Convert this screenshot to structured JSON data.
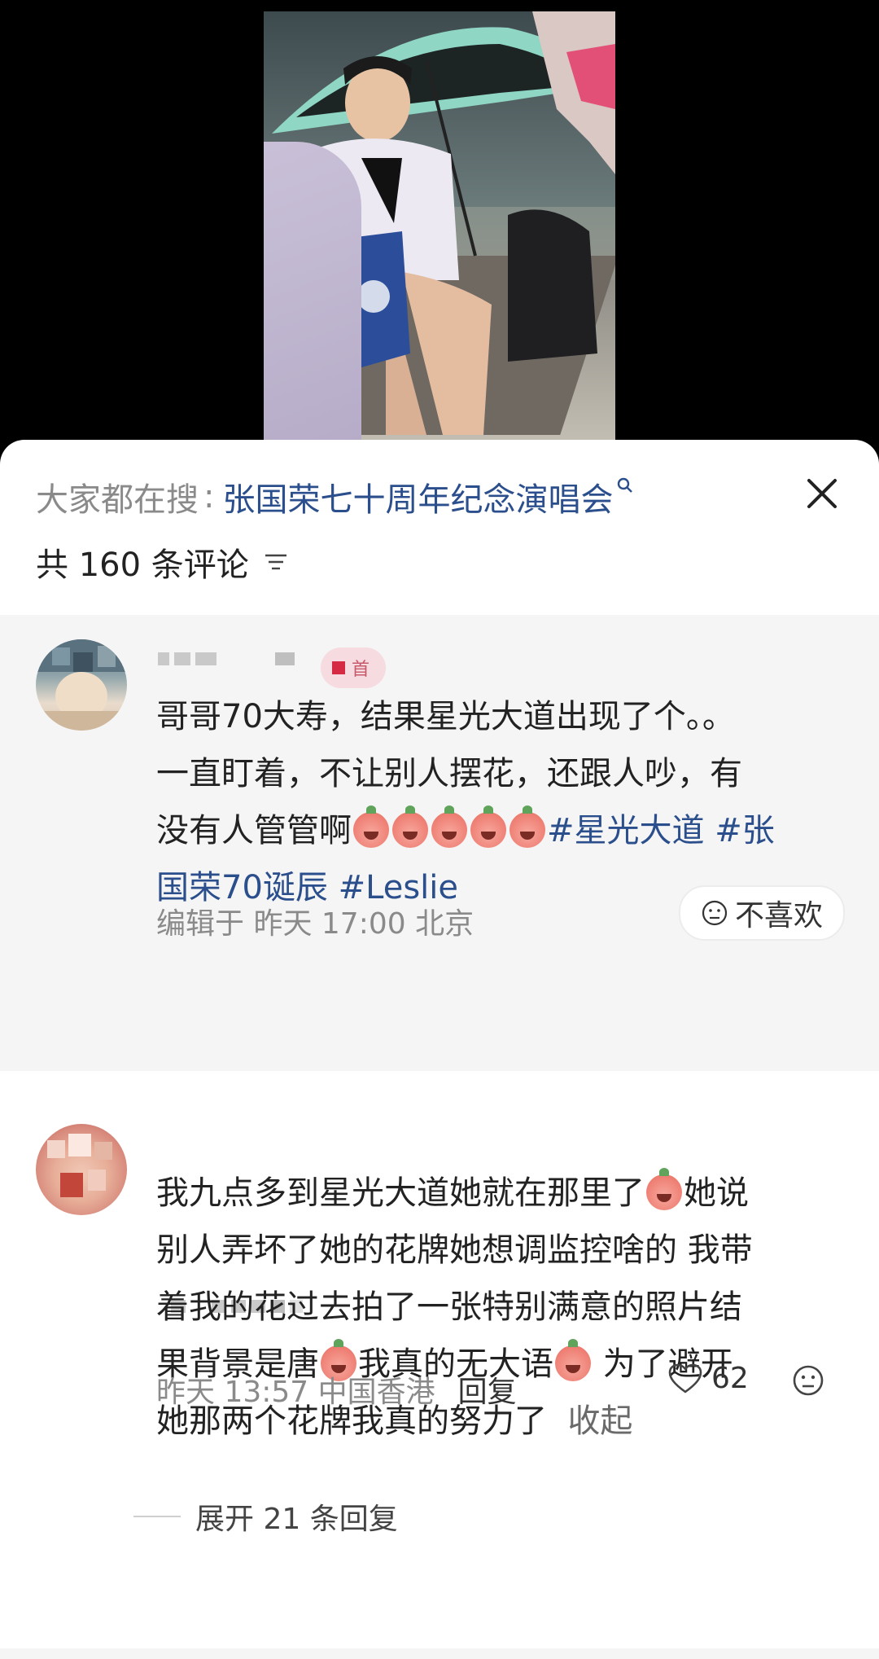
{
  "search": {
    "prefix": "大家都在搜",
    "separator": ":",
    "term": "张国荣七十周年纪念演唱会"
  },
  "comments_header": {
    "count_label": "共 160 条评论"
  },
  "comment1": {
    "badge_text": "首",
    "text_line1": "哥哥70大寿，结果星光大道出现了个。。",
    "text_line2": "一直盯着，不让别人摆花，还跟人吵，有",
    "text_line3_plain": "没有人管管啊",
    "tag1": "#星光大道",
    "tag2_part1": "#张",
    "tag2_part2": "国荣70诞辰",
    "tag3": "#Leslie",
    "meta": "编辑于  昨天 17:00 北京",
    "dislike_label": "不喜欢"
  },
  "comment2": {
    "seg1": "我九点多到星光大道她就在那里了",
    "seg2": "她说",
    "line2": "别人弄坏了她的花牌她想调监控啥的 我带",
    "line3": "着我的花过去拍了一张特别满意的照片结",
    "seg4a": "果背景是唐",
    "seg4b": "我真的无大语",
    "seg4c": " 为了避开",
    "seg5": "她那两个花牌我真的努力了",
    "collapse_label": "收起",
    "meta": "昨天 13:57 中国香港",
    "reply_label": "回复",
    "like_count": "62",
    "expand_label": "展开 21 条回复"
  },
  "icons": {
    "search": "search-icon",
    "close": "close-icon",
    "sort": "sort-icon",
    "like": "heart-icon",
    "dislike": "dislike-face-icon"
  },
  "colors": {
    "tag": "#2b4e8c",
    "muted": "#8a8a8a",
    "highlight_bg": "#f5f5f5"
  }
}
